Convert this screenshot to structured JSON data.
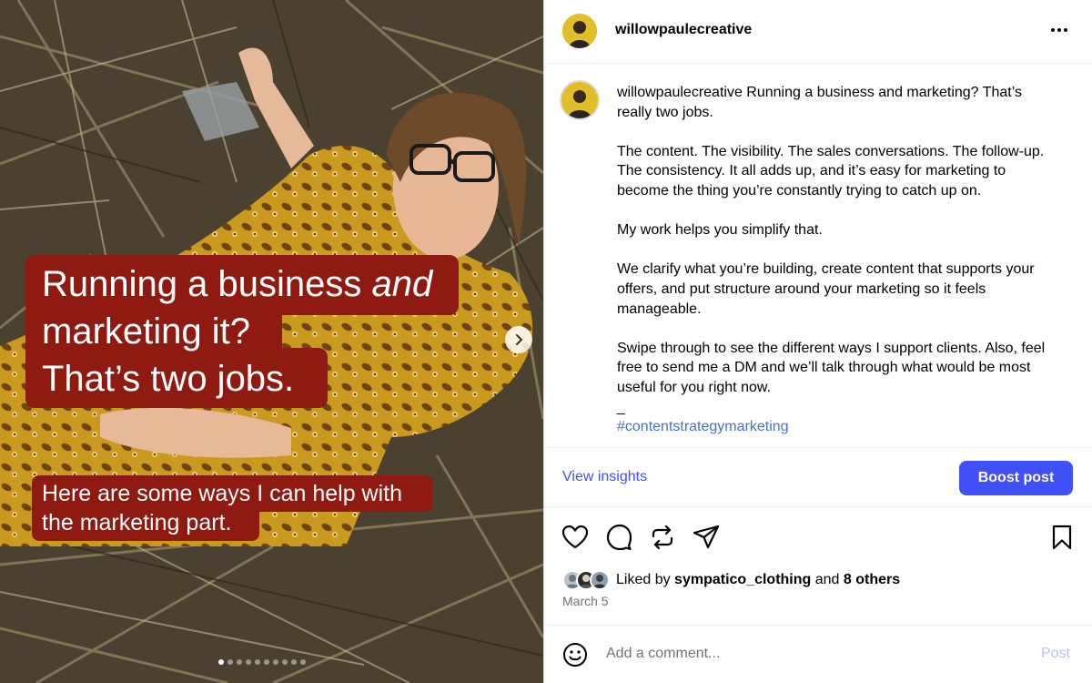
{
  "media": {
    "caption_main": {
      "line1_a": "Running a business ",
      "line1_b": "and",
      "line2": "marketing it?",
      "line3": "That’s two jobs."
    },
    "caption_sub": {
      "line1": "Here are some ways I can help with",
      "line2": "the marketing part."
    },
    "slide_count": 10,
    "active_slide": 1,
    "caption_color": "#8e1a12"
  },
  "header": {
    "username": "willowpaulecreative",
    "more_icon": "more-horizontal-icon"
  },
  "post": {
    "username": "willowpaulecreative",
    "paragraphs": [
      "Running a business and marketing? That’s really two jobs.",
      "The content. The visibility. The sales conversations. The follow-up. The consistency. It all adds up, and it’s easy for marketing to become the thing you’re constantly trying to catch up on.",
      "My work helps you simplify that.",
      "We clarify what you’re building, create content that supports your offers, and put structure around your marketing so it feels manageable.",
      "Swipe through to see the different ways I support clients. Also, feel free to send me a DM and we’ll talk through what would be most useful for you right now."
    ],
    "separator": "_",
    "hashtag": "#contentstrategymarketing"
  },
  "insights": {
    "view_label": "View insights",
    "boost_label": "Boost post",
    "accent": "#4150f7"
  },
  "actions": {
    "icons": [
      "heart-icon",
      "comment-icon",
      "repost-icon",
      "share-icon",
      "bookmark-icon"
    ]
  },
  "likes": {
    "prefix": "Liked by ",
    "user": "sympatico_clothing",
    "middle": " and ",
    "others": "8 others"
  },
  "date": "March 5",
  "comment": {
    "placeholder": "Add a comment...",
    "post_label": "Post"
  }
}
